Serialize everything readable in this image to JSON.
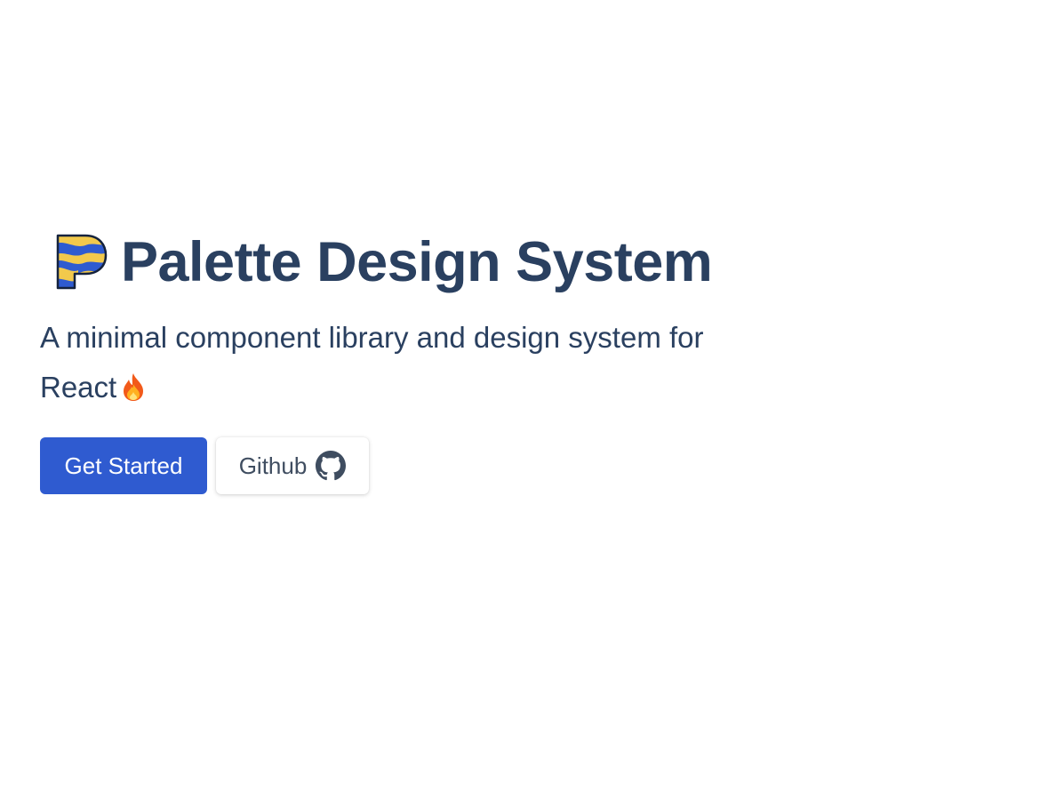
{
  "hero": {
    "title": "Palette Design System",
    "tagline": "A minimal component library and design system for React",
    "tagline_emoji_icon": "fire-icon",
    "logo_icon": "palette-logo-icon"
  },
  "actions": {
    "get_started_label": "Get Started",
    "github_label": "Github",
    "github_icon": "github-icon"
  },
  "colors": {
    "text": "#2a4060",
    "primary": "#2f5bd0",
    "logo_yellow": "#f2c94c",
    "logo_blue": "#2f5bd0"
  }
}
